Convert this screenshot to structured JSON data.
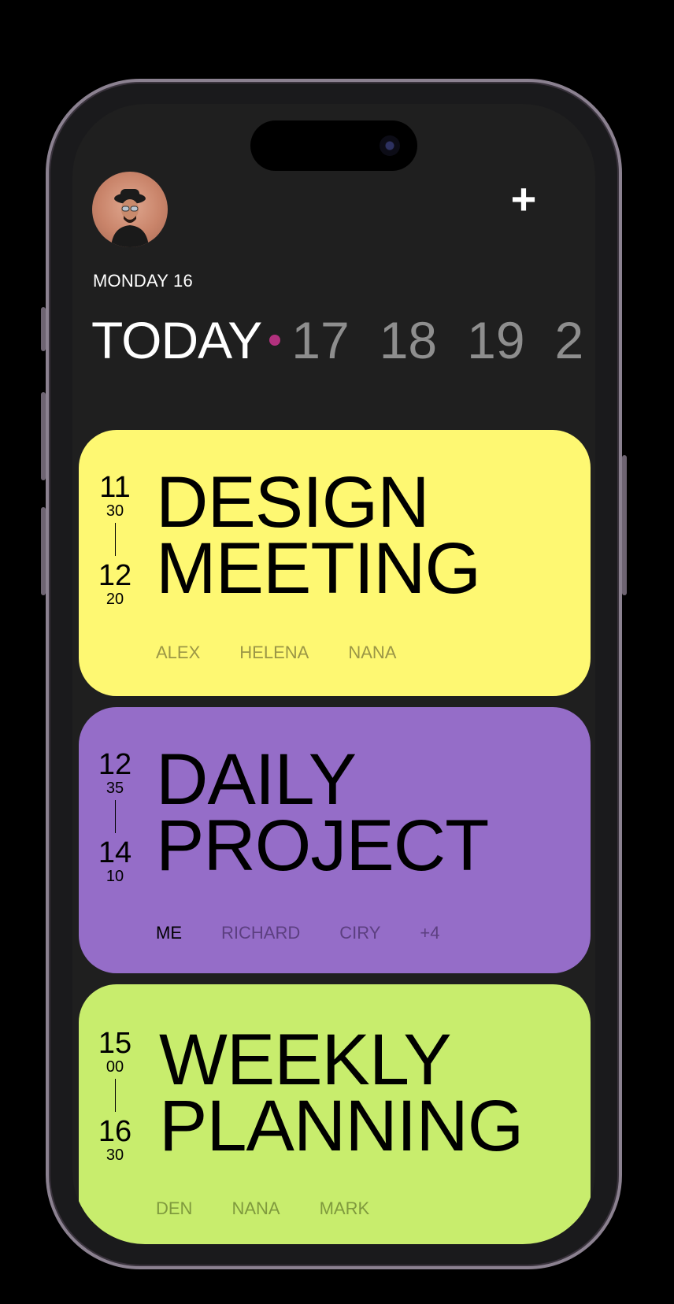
{
  "header": {
    "date_label": "MONDAY 16",
    "add_label": "+"
  },
  "day_strip": {
    "today": "TODAY",
    "days": [
      "17",
      "18",
      "19",
      "2"
    ]
  },
  "events": [
    {
      "start_hour": "11",
      "start_min": "30",
      "end_hour": "12",
      "end_min": "20",
      "title_line1": "DESIGN",
      "title_line2": "MEETING",
      "people": [
        "ALEX",
        "HELENA",
        "NANA"
      ],
      "color": "#fef872"
    },
    {
      "start_hour": "12",
      "start_min": "35",
      "end_hour": "14",
      "end_min": "10",
      "title_line1": "DAILY",
      "title_line2": "PROJECT",
      "people": [
        "ME",
        "RICHARD",
        "CIRY",
        "+4"
      ],
      "color": "#956dc8"
    },
    {
      "start_hour": "15",
      "start_min": "00",
      "end_hour": "16",
      "end_min": "30",
      "title_line1": "WEEKLY",
      "title_line2": "PLANNING",
      "people": [
        "DEN",
        "NANA",
        "MARK"
      ],
      "color": "#c8ed6d"
    }
  ],
  "colors": {
    "accent_dot": "#b2317e",
    "screen_bg": "#1f1f1f"
  }
}
